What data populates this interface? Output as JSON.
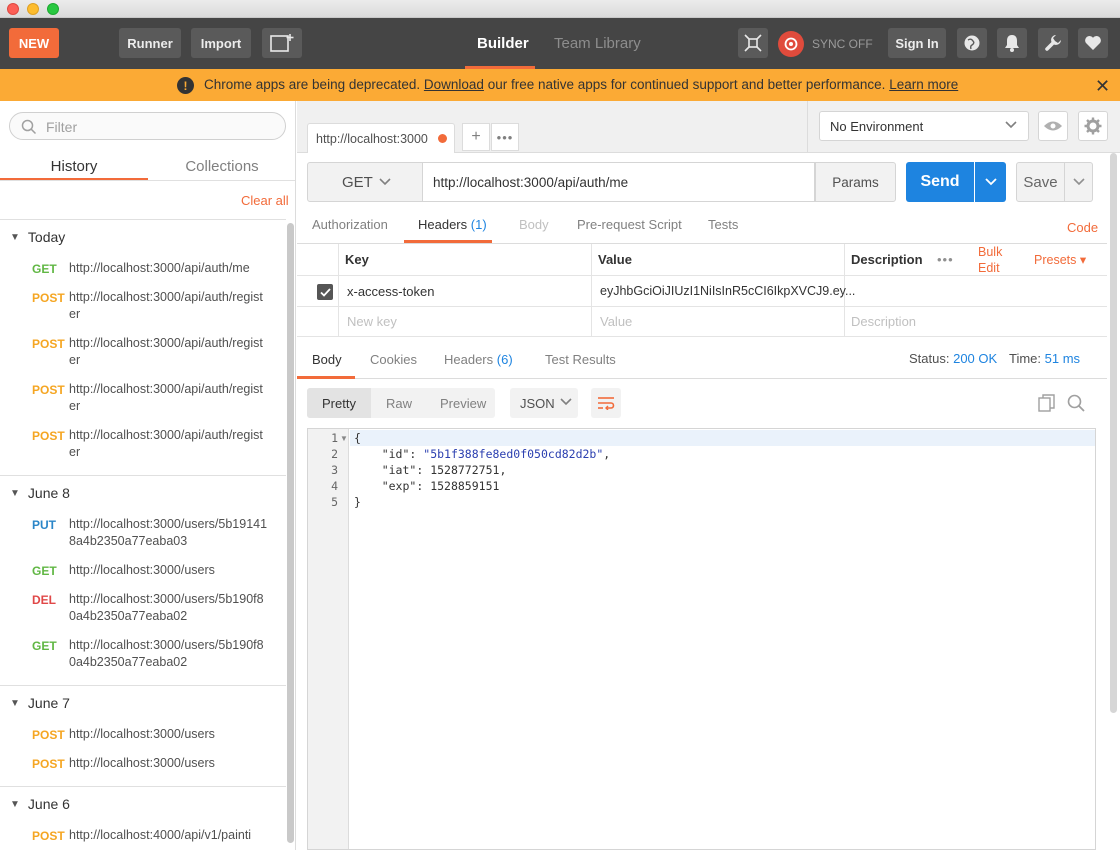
{
  "toolbar": {
    "new_label": "NEW",
    "runner_label": "Runner",
    "import_label": "Import",
    "tab_builder": "Builder",
    "tab_team_library": "Team Library",
    "sync_label": "SYNC OFF",
    "signin_label": "Sign In"
  },
  "banner": {
    "text_before": "Chrome apps are being deprecated. ",
    "download_link": "Download",
    "text_after": " our free native apps for continued support and better performance. ",
    "learn_more": "Learn more",
    "close": "✕"
  },
  "sidebar": {
    "filter_placeholder": "Filter",
    "tab_history": "History",
    "tab_collections": "Collections",
    "clear_all": "Clear all",
    "groups": [
      {
        "label": "Today",
        "items": [
          {
            "method": "GET",
            "url": "http://localhost:3000/api/auth/me"
          },
          {
            "method": "POST",
            "url": "http://localhost:3000/api/auth/register"
          },
          {
            "method": "POST",
            "url": "http://localhost:3000/api/auth/register"
          },
          {
            "method": "POST",
            "url": "http://localhost:3000/api/auth/register"
          },
          {
            "method": "POST",
            "url": "http://localhost:3000/api/auth/register"
          }
        ]
      },
      {
        "label": "June 8",
        "items": [
          {
            "method": "PUT",
            "url": "http://localhost:3000/users/5b191418a4b2350a77eaba03"
          },
          {
            "method": "GET",
            "url": "http://localhost:3000/users"
          },
          {
            "method": "DEL",
            "url": "http://localhost:3000/users/5b190f80a4b2350a77eaba02"
          },
          {
            "method": "GET",
            "url": "http://localhost:3000/users/5b190f80a4b2350a77eaba02"
          }
        ]
      },
      {
        "label": "June 7",
        "items": [
          {
            "method": "POST",
            "url": "http://localhost:3000/users"
          },
          {
            "method": "POST",
            "url": "http://localhost:3000/users"
          }
        ]
      },
      {
        "label": "June 6",
        "items": [
          {
            "method": "POST",
            "url": "http://localhost:4000/api/v1/painti"
          }
        ]
      }
    ]
  },
  "request": {
    "tab_title": "http://localhost:3000",
    "add_tab": "+",
    "more_tabs": "•••",
    "environment": "No Environment",
    "method": "GET",
    "url": "http://localhost:3000/api/auth/me",
    "params_label": "Params",
    "send_label": "Send",
    "save_label": "Save",
    "subtabs": {
      "authorization": "Authorization",
      "headers": "Headers",
      "headers_count": "(1)",
      "body": "Body",
      "prerequest": "Pre-request Script",
      "tests": "Tests"
    },
    "code_link": "Code",
    "headers_table": {
      "col_key": "Key",
      "col_value": "Value",
      "col_description": "Description",
      "more": "•••",
      "bulk_edit": "Bulk Edit",
      "presets": "Presets ▾",
      "rows": [
        {
          "checked": true,
          "key": "x-access-token",
          "value": "eyJhbGciOiJIUzI1NiIsInR5cCI6IkpXVCJ9.ey...",
          "description": ""
        }
      ],
      "placeholder_key": "New key",
      "placeholder_value": "Value",
      "placeholder_description": "Description"
    }
  },
  "response": {
    "tabs": {
      "body": "Body",
      "cookies": "Cookies",
      "headers": "Headers",
      "headers_count": "(6)",
      "test_results": "Test Results"
    },
    "status_label": "Status:",
    "status_value": "200 OK",
    "time_label": "Time:",
    "time_value": "51 ms",
    "format": {
      "pretty": "Pretty",
      "raw": "Raw",
      "preview": "Preview",
      "language": "JSON"
    },
    "body_lines": [
      {
        "num": "1",
        "text": "{"
      },
      {
        "num": "2",
        "key": "\"id\"",
        "value": "\"5b1f388fe8ed0f050cd82d2b\"",
        "trail": ","
      },
      {
        "num": "3",
        "key": "\"iat\"",
        "value": "1528772751",
        "trail": ","
      },
      {
        "num": "4",
        "key": "\"exp\"",
        "value": "1528859151",
        "trail": ""
      },
      {
        "num": "5",
        "text": "}"
      }
    ]
  },
  "colors": {
    "accent": "#f26b3a",
    "send_blue": "#1e84e0",
    "banner": "#fbaa35",
    "toolbar": "#454545"
  }
}
